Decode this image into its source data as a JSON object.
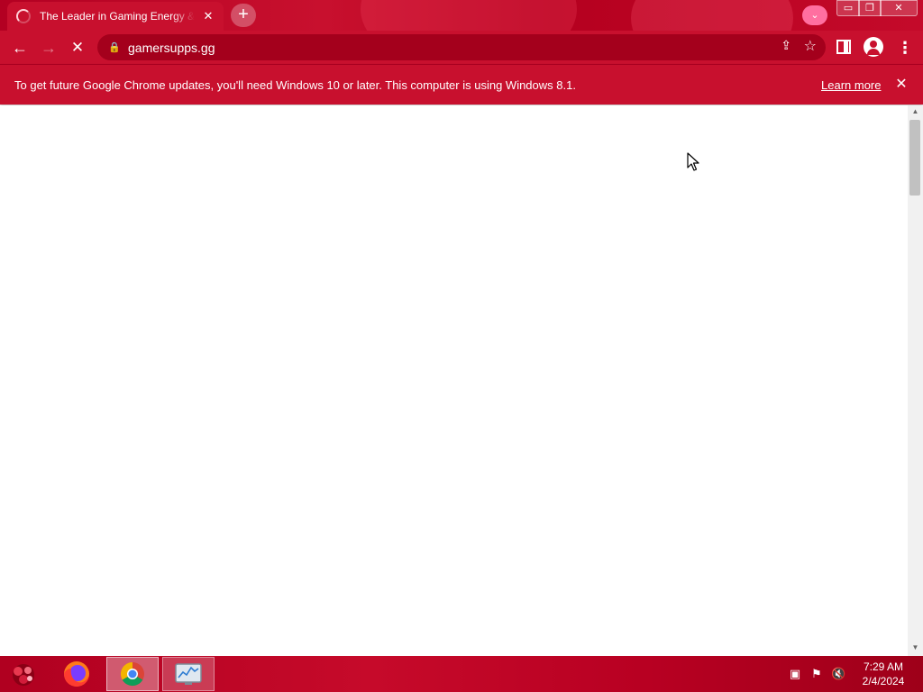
{
  "browser": {
    "tab": {
      "title": "The Leader in Gaming Energy & Focus",
      "close_glyph": "✕"
    },
    "new_tab_glyph": "+",
    "tab_search_glyph": "⌄",
    "window_controls": {
      "minimize": "▭",
      "maximize": "❐",
      "close": "✕"
    },
    "toolbar": {
      "back_glyph": "←",
      "forward_glyph": "→",
      "stop_glyph": "✕",
      "lock_glyph": "🔒",
      "url": "gamersupps.gg",
      "share_glyph": "⇪",
      "star_glyph": "☆",
      "menu_glyph": "⋮"
    },
    "infobar": {
      "message": "To get future Google Chrome updates, you'll need Windows 10 or later. This computer is using Windows 8.1.",
      "learn_more": "Learn more",
      "close_glyph": "✕"
    }
  },
  "taskbar": {
    "apps": [
      "Firefox",
      "Google Chrome",
      "Resource Monitor"
    ],
    "tray": {
      "network_glyph": "▣",
      "flag_glyph": "⚑",
      "volume_glyph": "🔇"
    },
    "clock": {
      "time": "7:29 AM",
      "date": "2/4/2024"
    }
  },
  "colors": {
    "theme_red": "#c8102e",
    "omnibox": "#a4001c",
    "content_bg": "#ffffff"
  },
  "icons": [
    "back-arrow-icon",
    "forward-arrow-icon",
    "stop-icon",
    "lock-icon",
    "share-icon",
    "star-icon",
    "side-panel-icon",
    "profile-icon",
    "menu-icon",
    "firefox-icon",
    "chrome-icon",
    "monitor-icon"
  ]
}
